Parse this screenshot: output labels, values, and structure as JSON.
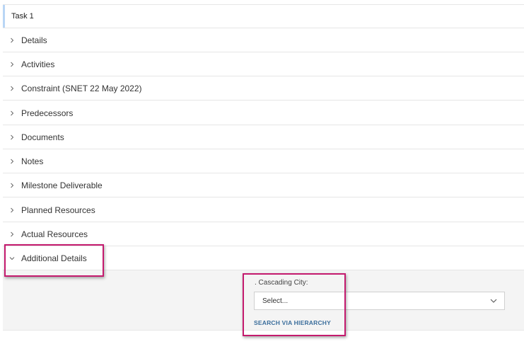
{
  "task": {
    "title": "Task 1"
  },
  "sections": [
    {
      "label": "Details",
      "expanded": false
    },
    {
      "label": "Activities",
      "expanded": false
    },
    {
      "label": "Constraint (SNET 22 May 2022)",
      "expanded": false
    },
    {
      "label": "Predecessors",
      "expanded": false
    },
    {
      "label": "Documents",
      "expanded": false
    },
    {
      "label": "Notes",
      "expanded": false
    },
    {
      "label": "Milestone Deliverable",
      "expanded": false
    },
    {
      "label": "Planned Resources",
      "expanded": false
    },
    {
      "label": "Actual Resources",
      "expanded": false
    },
    {
      "label": "Additional Details",
      "expanded": true
    }
  ],
  "additional_details": {
    "field_label": ". Cascading City:",
    "select_value": "Select...",
    "search_link": "SEARCH VIA HIERARCHY"
  },
  "icons": {
    "collapsed": "chevron-right-icon",
    "expanded": "chevron-down-icon",
    "select": "chevron-down-icon"
  },
  "colors": {
    "accent": "#b9d6f5",
    "highlight": "#c41a6e",
    "link": "#3b6e9c",
    "panel_bg": "#f4f4f4"
  }
}
